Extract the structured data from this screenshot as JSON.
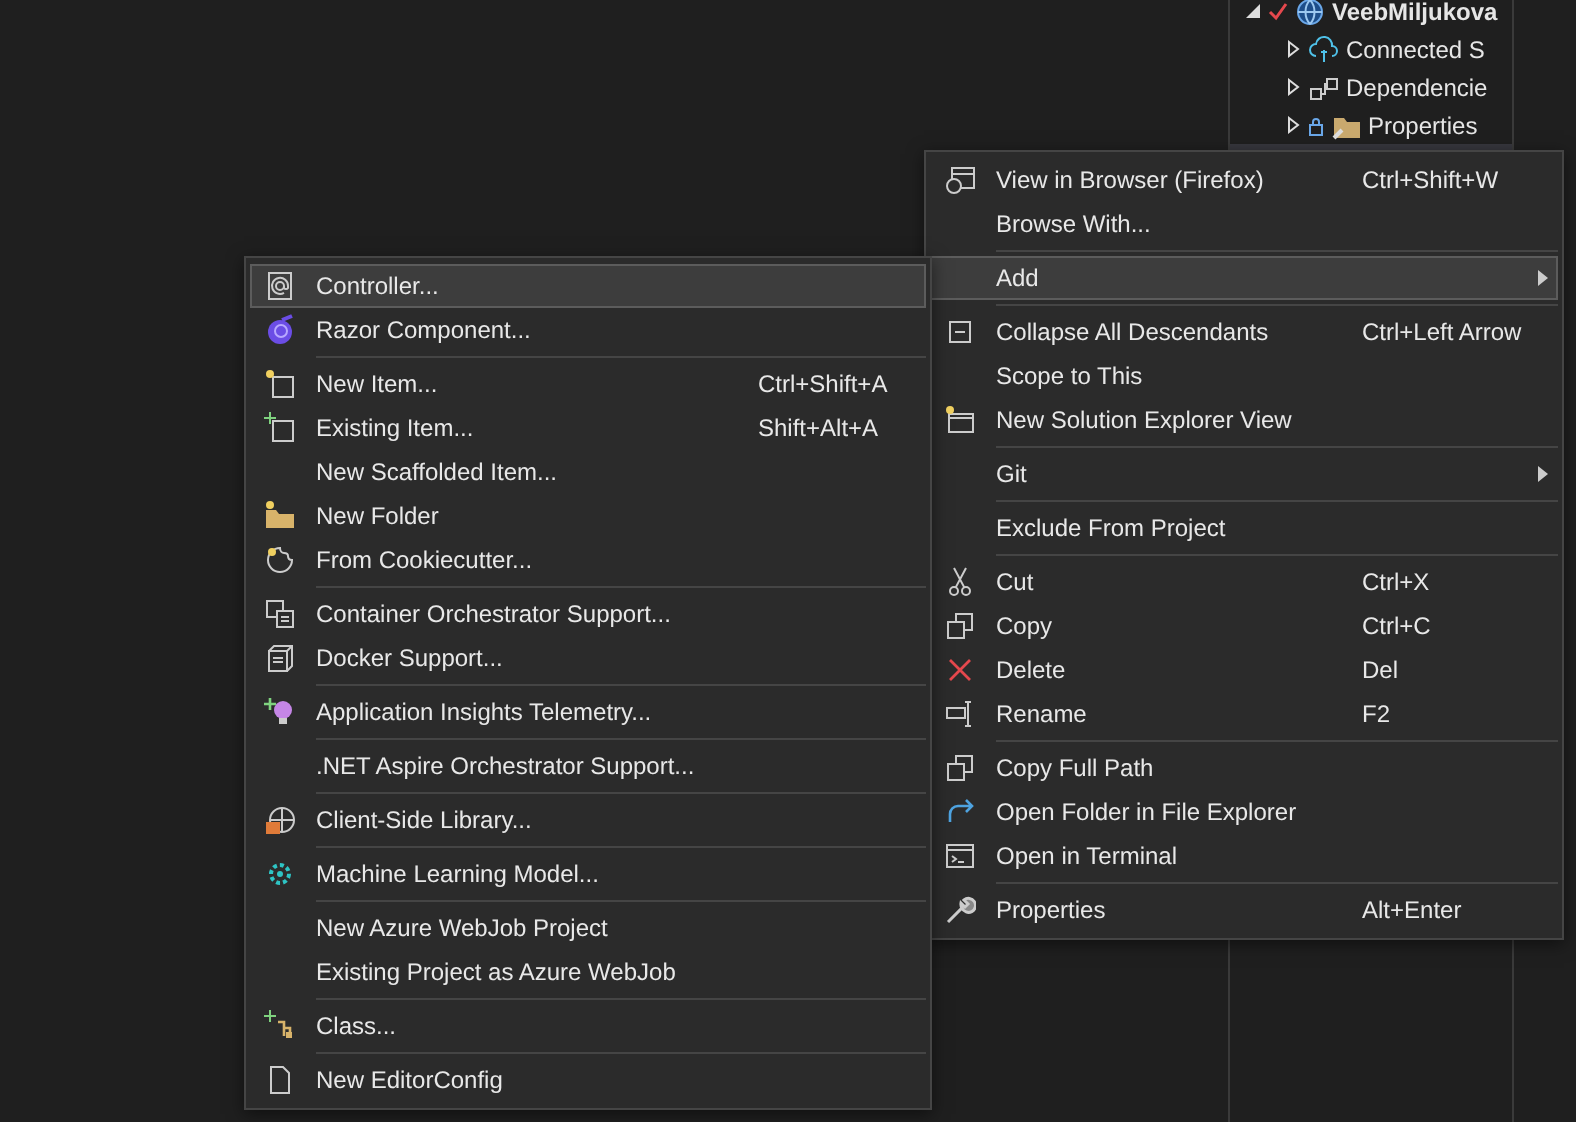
{
  "solution_explorer": {
    "items": [
      {
        "label": "VeebMiljukova",
        "expanded": true
      },
      {
        "label": "Connected S",
        "expanded": false
      },
      {
        "label": "Dependencie",
        "expanded": false
      },
      {
        "label": "Properties",
        "expanded": false
      }
    ]
  },
  "context_menu": {
    "items": [
      {
        "kind": "item",
        "label": "View in Browser (Firefox)",
        "shortcut": "Ctrl+Shift+W",
        "selected": false,
        "submenu": false
      },
      {
        "kind": "item",
        "label": "Browse With...",
        "selected": false,
        "submenu": false
      },
      {
        "kind": "separator"
      },
      {
        "kind": "item",
        "label": "Add",
        "selected": true,
        "submenu": true
      },
      {
        "kind": "separator"
      },
      {
        "kind": "item",
        "label": "Collapse All Descendants",
        "shortcut": "Ctrl+Left Arrow",
        "selected": false,
        "submenu": false
      },
      {
        "kind": "item",
        "label": "Scope to This",
        "selected": false,
        "submenu": false
      },
      {
        "kind": "item",
        "label": "New Solution Explorer View",
        "selected": false,
        "submenu": false
      },
      {
        "kind": "separator"
      },
      {
        "kind": "item",
        "label": "Git",
        "selected": false,
        "submenu": true
      },
      {
        "kind": "separator"
      },
      {
        "kind": "item",
        "label": "Exclude From Project",
        "selected": false,
        "submenu": false
      },
      {
        "kind": "separator"
      },
      {
        "kind": "item",
        "label": "Cut",
        "shortcut": "Ctrl+X",
        "selected": false,
        "submenu": false
      },
      {
        "kind": "item",
        "label": "Copy",
        "shortcut": "Ctrl+C",
        "selected": false,
        "submenu": false
      },
      {
        "kind": "item",
        "label": "Delete",
        "shortcut": "Del",
        "selected": false,
        "submenu": false
      },
      {
        "kind": "item",
        "label": "Rename",
        "shortcut": "F2",
        "selected": false,
        "submenu": false
      },
      {
        "kind": "separator"
      },
      {
        "kind": "item",
        "label": "Copy Full Path",
        "selected": false,
        "submenu": false
      },
      {
        "kind": "item",
        "label": "Open Folder in File Explorer",
        "selected": false,
        "submenu": false
      },
      {
        "kind": "item",
        "label": "Open in Terminal",
        "selected": false,
        "submenu": false
      },
      {
        "kind": "separator"
      },
      {
        "kind": "item",
        "label": "Properties",
        "shortcut": "Alt+Enter",
        "selected": false,
        "submenu": false
      }
    ]
  },
  "add_submenu": {
    "items": [
      {
        "kind": "item",
        "label": "Controller...",
        "selected": true
      },
      {
        "kind": "item",
        "label": "Razor Component...",
        "selected": false
      },
      {
        "kind": "separator"
      },
      {
        "kind": "item",
        "label": "New Item...",
        "shortcut": "Ctrl+Shift+A",
        "selected": false
      },
      {
        "kind": "item",
        "label": "Existing Item...",
        "shortcut": "Shift+Alt+A",
        "selected": false
      },
      {
        "kind": "item",
        "label": "New Scaffolded Item...",
        "selected": false
      },
      {
        "kind": "item",
        "label": "New Folder",
        "selected": false
      },
      {
        "kind": "item",
        "label": "From Cookiecutter...",
        "selected": false
      },
      {
        "kind": "separator"
      },
      {
        "kind": "item",
        "label": "Container Orchestrator Support...",
        "selected": false
      },
      {
        "kind": "item",
        "label": "Docker Support...",
        "selected": false
      },
      {
        "kind": "separator"
      },
      {
        "kind": "item",
        "label": "Application Insights Telemetry...",
        "selected": false
      },
      {
        "kind": "separator"
      },
      {
        "kind": "item",
        "label": ".NET Aspire Orchestrator Support...",
        "selected": false
      },
      {
        "kind": "separator"
      },
      {
        "kind": "item",
        "label": "Client-Side Library...",
        "selected": false
      },
      {
        "kind": "separator"
      },
      {
        "kind": "item",
        "label": "Machine Learning Model...",
        "selected": false
      },
      {
        "kind": "separator"
      },
      {
        "kind": "item",
        "label": "New Azure WebJob Project",
        "selected": false
      },
      {
        "kind": "item",
        "label": "Existing Project as Azure WebJob",
        "selected": false
      },
      {
        "kind": "separator"
      },
      {
        "kind": "item",
        "label": "Class...",
        "selected": false
      },
      {
        "kind": "separator"
      },
      {
        "kind": "item",
        "label": "New EditorConfig",
        "selected": false
      }
    ]
  }
}
